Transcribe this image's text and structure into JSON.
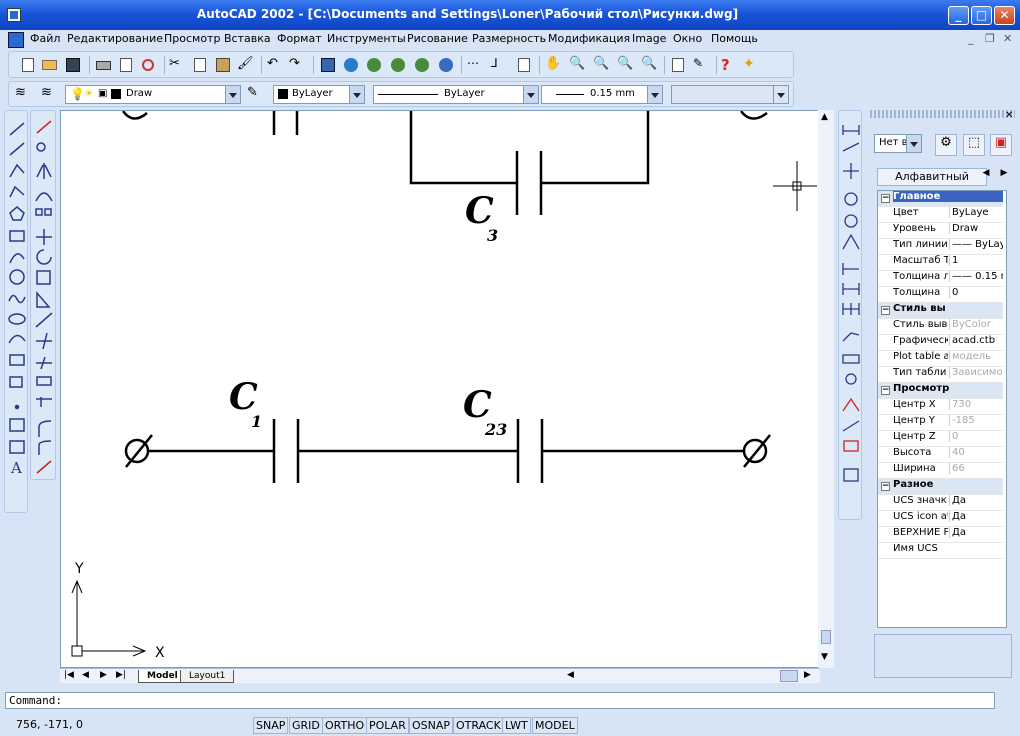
{
  "title": "AutoCAD 2002 - [C:\\Documents and Settings\\Loner\\Рабочий стол\\Рисунки.dwg]",
  "menu": [
    "Файл",
    "Редактирование",
    "Просмотр",
    "Вставка",
    "Формат",
    "Инструменты",
    "Рисование",
    "Размерность",
    "Модификация",
    "Image",
    "Окно",
    "Помощь"
  ],
  "layer_combo": "Draw",
  "color_combo": "ByLayer",
  "linetype_combo": "ByLayer",
  "lineweight_combo": "0.15 mm",
  "props": {
    "filter_combo": "Нет в",
    "tab_label": "Алфавитный",
    "rows": [
      {
        "name": "Главное",
        "value": "",
        "group": true
      },
      {
        "name": "Цвет",
        "value": "ByLaye"
      },
      {
        "name": "Уровень",
        "value": "Draw"
      },
      {
        "name": "Тип линии",
        "value": "—— ByLay"
      },
      {
        "name": "Масштаб Т",
        "value": "1"
      },
      {
        "name": "Толщина л",
        "value": "—— 0.15 r"
      },
      {
        "name": "Толщина",
        "value": "0"
      },
      {
        "name": "Стиль вы",
        "value": "",
        "group": true
      },
      {
        "name": "Стиль выв",
        "value": "ByColor"
      },
      {
        "name": "Графическ",
        "value": "acad.ctb"
      },
      {
        "name": "Plot table a",
        "value": "модель"
      },
      {
        "name": "Тип табли",
        "value": "Зависимос"
      },
      {
        "name": "Просмотр",
        "value": "",
        "group": true
      },
      {
        "name": "Центр X",
        "value": "730"
      },
      {
        "name": "Центр Y",
        "value": "-185"
      },
      {
        "name": "Центр Z",
        "value": "0"
      },
      {
        "name": "Высота",
        "value": "40"
      },
      {
        "name": "Ширина",
        "value": "66"
      },
      {
        "name": "Разное",
        "value": "",
        "group": true
      },
      {
        "name": "UCS значк",
        "value": "Да"
      },
      {
        "name": "UCS icon at",
        "value": "Да"
      },
      {
        "name": "ВЕРХНИЕ Р",
        "value": "Да"
      },
      {
        "name": "Имя UCS",
        "value": ""
      }
    ]
  },
  "drawing": {
    "labels": {
      "c3": "C",
      "c3_sub": "3",
      "c1": "C",
      "c1_sub": "1",
      "c23": "C",
      "c23_sub": "23",
      "axis_x": "X",
      "axis_y": "Y"
    },
    "tabs": [
      "Model",
      "Layout1"
    ]
  },
  "command_prompt": "Command:",
  "status": {
    "coords": "756, -171, 0",
    "buttons": [
      "SNAP",
      "GRID",
      "ORTHO",
      "POLAR",
      "OSNAP",
      "OTRACK",
      "LWT",
      "MODEL"
    ]
  },
  "colors": {
    "titlebar": "#1a55d8",
    "chrome": "#d6e4f5",
    "canvas": "#ffffff",
    "ink": "#000000"
  }
}
